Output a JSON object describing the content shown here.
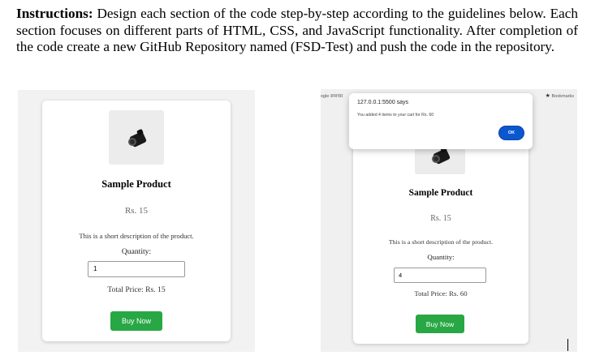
{
  "instructions": {
    "bold_lead": "Instructions:",
    "text": " Design each section of the code step-by-step according to the guidelines below. Each section focuses on different parts of HTML, CSS, and JavaScript functionality. After completion of the code create a new GitHub Repository named (FSD-Test) and push the code in the repository."
  },
  "left_screenshot": {
    "product_title": "Sample Product",
    "price": "Rs. 15",
    "description": "This is a short description of the product.",
    "quantity_label": "Quantity:",
    "quantity_value": "1",
    "total_price": "Total Price: Rs. 15",
    "buy_button": "Buy Now"
  },
  "right_screenshot": {
    "browser_left_text": "ogle समाचार",
    "bookmarks_label": "Bookmarks",
    "alert": {
      "title": "127.0.0.1:5500 says",
      "message": "You added 4 items to your cart for Rs. 60",
      "ok_button": "OK"
    },
    "product_title": "Sample Product",
    "price": "Rs. 15",
    "description": "This is a short description of the product.",
    "quantity_label": "Quantity:",
    "quantity_value": "4",
    "total_price": "Total Price: Rs. 60",
    "buy_button": "Buy Now"
  },
  "colors": {
    "buy_button": "#28a745",
    "alert_ok": "#0b57d0",
    "screenshot_bg": "#f2f2f2"
  }
}
